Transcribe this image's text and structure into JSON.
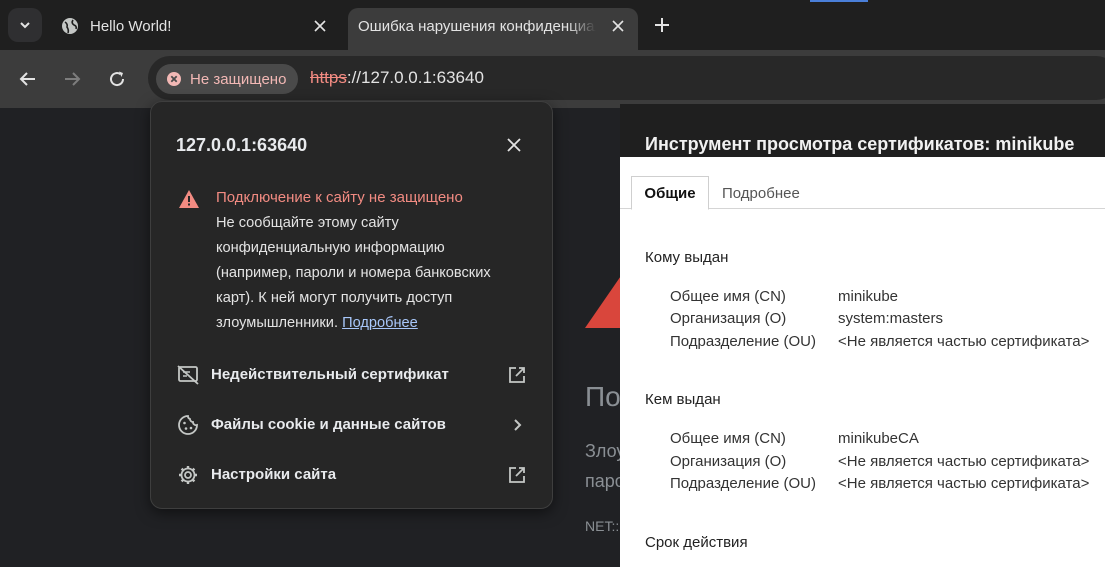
{
  "tabs": [
    {
      "title": "Hello World!"
    },
    {
      "title": "Ошибка нарушения конфиденциальности"
    }
  ],
  "toolbar": {
    "security_chip": "Не защищено",
    "url_scheme": "https",
    "url_rest": "://127.0.0.1:63640"
  },
  "background_page": {
    "heading": "По",
    "line1": "Злоу",
    "line2": "паро",
    "net": "NET::"
  },
  "popup": {
    "host": "127.0.0.1:63640",
    "warning_title": "Подключение к сайту не защищено",
    "warning_body": "Не сообщайте этому сайту конфиденциальную информацию (например, пароли и номера банковских карт). К ней могут получить доступ злоумышленники. ",
    "learn_more": "Подробнее",
    "rows": [
      {
        "label": "Недействительный сертификат",
        "icon": "certificate-off-icon",
        "trailing": "open-in-new-icon"
      },
      {
        "label": "Файлы cookie и данные сайтов",
        "icon": "cookie-icon",
        "trailing": "chevron-right-icon"
      },
      {
        "label": "Настройки сайта",
        "icon": "settings-gear-icon",
        "trailing": "open-in-new-icon"
      }
    ]
  },
  "cert_viewer": {
    "title": "Инструмент просмотра сертификатов: minikube",
    "tabs": [
      "Общие",
      "Подробнее"
    ],
    "issued_to": {
      "title": "Кому выдан",
      "fields": [
        {
          "name": "Общее имя (CN)",
          "value": "minikube"
        },
        {
          "name": "Организация (O)",
          "value": "system:masters"
        },
        {
          "name": "Подразделение (OU)",
          "value": "<Не является частью сертификата>"
        }
      ]
    },
    "issued_by": {
      "title": "Кем выдан",
      "fields": [
        {
          "name": "Общее имя (CN)",
          "value": "minikubeCA"
        },
        {
          "name": "Организация (O)",
          "value": "<Не является частью сертификата>"
        },
        {
          "name": "Подразделение (OU)",
          "value": "<Не является частью сертификата>"
        }
      ]
    },
    "validity_title": "Срок действия"
  },
  "colors": {
    "warning_red": "#f28b82",
    "link_blue": "#a8c7fa",
    "popup_bg": "#262626",
    "toolbar_bg": "#3c3c3c"
  }
}
